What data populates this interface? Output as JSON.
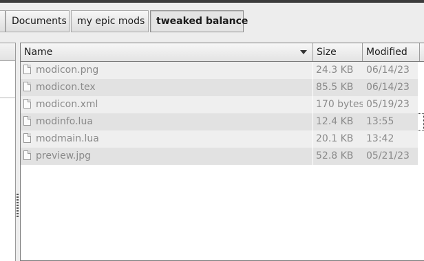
{
  "pathbar": {
    "crumbs": [
      {
        "label": "Documents"
      },
      {
        "label": "my epic mods"
      },
      {
        "label": "tweaked balance",
        "active": true
      }
    ]
  },
  "filelist": {
    "columns": {
      "name": "Name",
      "size": "Size",
      "modified": "Modified"
    },
    "sort_column": "Name",
    "rows": [
      {
        "name": "modicon.png",
        "size": "24.3 KB",
        "modified": "06/14/23"
      },
      {
        "name": "modicon.tex",
        "size": "85.5 KB",
        "modified": "06/14/23"
      },
      {
        "name": "modicon.xml",
        "size": "170 bytes",
        "modified": "05/19/23"
      },
      {
        "name": "modinfo.lua",
        "size": "12.4 KB",
        "modified": "13:55",
        "focused": true
      },
      {
        "name": "modmain.lua",
        "size": "20.1 KB",
        "modified": "13:42"
      },
      {
        "name": "preview.jpg",
        "size": "52.8 KB",
        "modified": "05/21/23"
      }
    ]
  }
}
